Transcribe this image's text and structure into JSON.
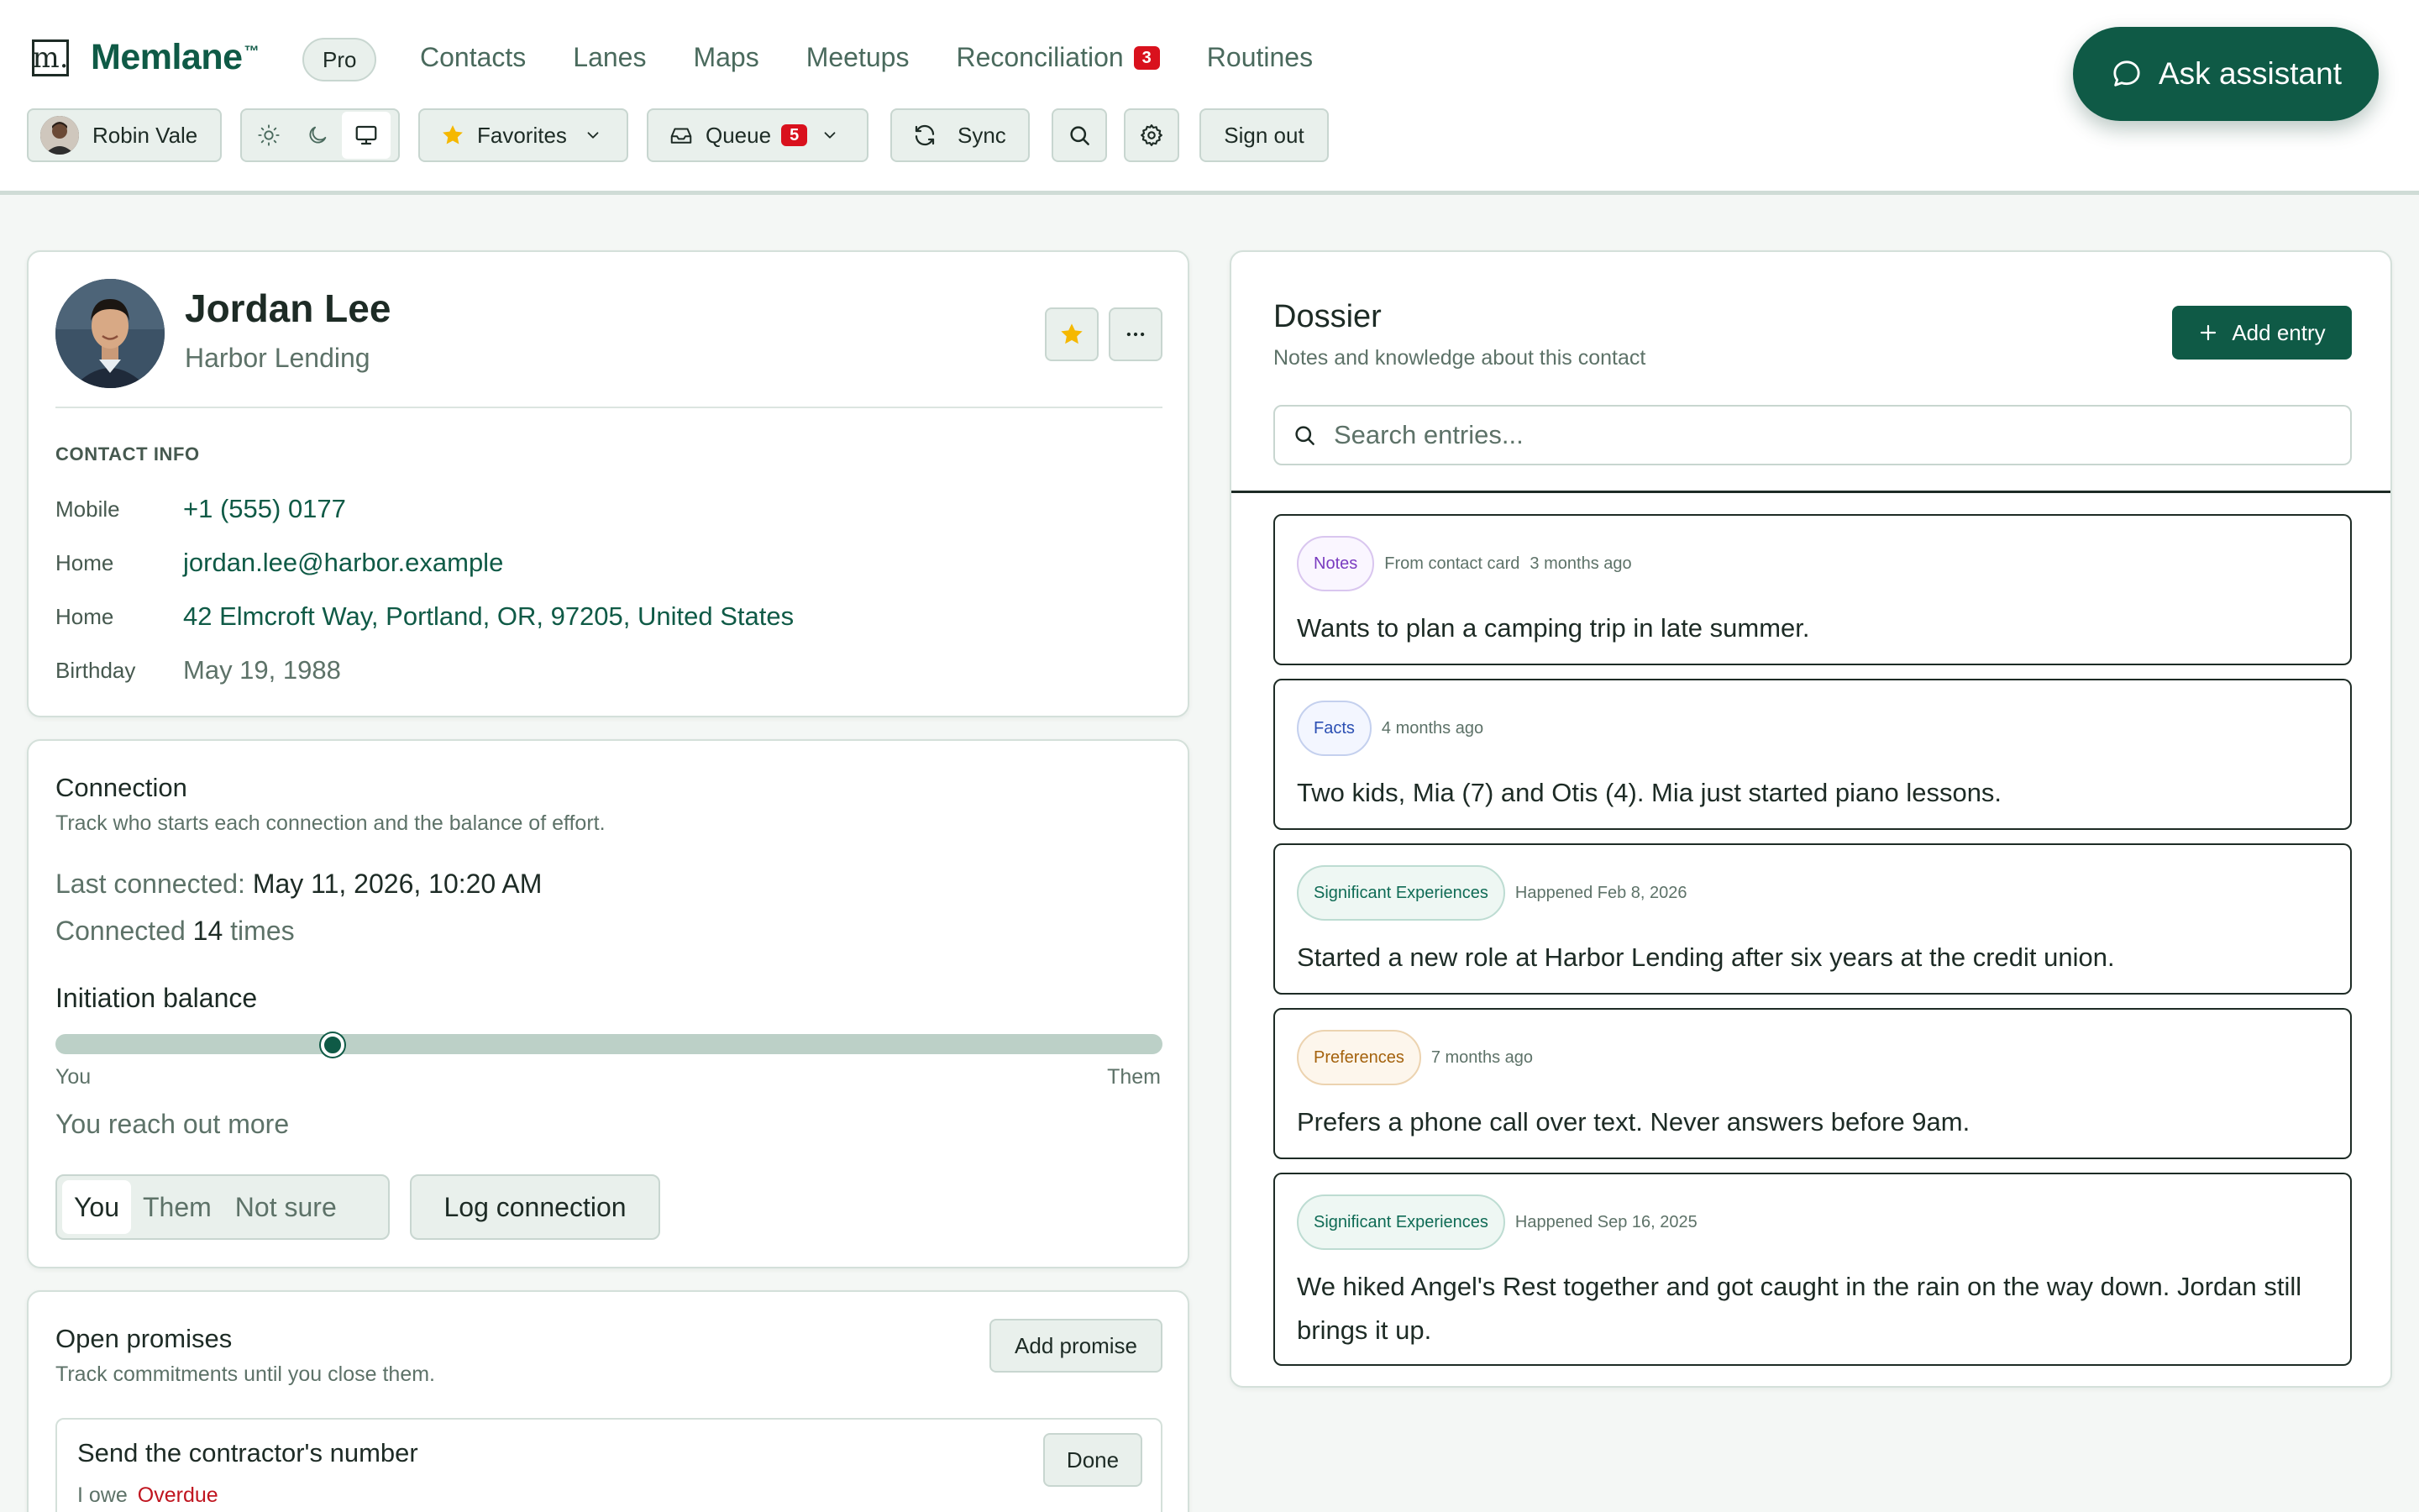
{
  "brand": {
    "logo_glyph": "m.",
    "name": "Memlane",
    "trademark": "™",
    "plan_badge": "Pro"
  },
  "nav": {
    "items": [
      {
        "label": "Contacts"
      },
      {
        "label": "Lanes"
      },
      {
        "label": "Maps"
      },
      {
        "label": "Meetups"
      },
      {
        "label": "Reconciliation",
        "count": "3"
      },
      {
        "label": "Routines"
      }
    ]
  },
  "toolbar": {
    "user_name": "Robin Vale",
    "theme_options": [
      "sun-icon",
      "moon-icon",
      "monitor-icon"
    ],
    "theme_selected": "monitor-icon",
    "favorites_label": "Favorites",
    "queue_label": "Queue",
    "queue_count": "5",
    "sync_label": "Sync",
    "sign_out_label": "Sign out"
  },
  "assistant": {
    "label": "Ask assistant"
  },
  "contact": {
    "name": "Jordan Lee",
    "company": "Harbor Lending",
    "favorited": true,
    "section_label": "CONTACT INFO",
    "info": [
      {
        "key": "Mobile",
        "value": "+1 (555) 0177",
        "link": true
      },
      {
        "key": "Home",
        "value": "jordan.lee@harbor.example",
        "link": true
      },
      {
        "key": "Home",
        "value": "42 Elmcroft Way, Portland, OR, 97205, United States",
        "link": true
      },
      {
        "key": "Birthday",
        "value": "May 19, 1988",
        "link": false
      }
    ]
  },
  "connection": {
    "title": "Connection",
    "subtitle": "Track who starts each connection and the balance of effort.",
    "last_connected_label": "Last connected:",
    "last_connected_value": "May 11, 2026, 10:20 AM",
    "count_prefix": "Connected",
    "count_value": "14",
    "count_suffix": "times",
    "balance_heading": "Initiation balance",
    "balance_fraction": 0.25,
    "left_label": "You",
    "right_label": "Them",
    "balance_summary": "You reach out more",
    "initiator_options": [
      "You",
      "Them",
      "Not sure"
    ],
    "initiator_selected": "You",
    "log_button": "Log connection"
  },
  "promises": {
    "title": "Open promises",
    "subtitle": "Track commitments until you close them.",
    "add_button": "Add promise",
    "items": [
      {
        "title": "Send the contractor's number",
        "direction": "I owe",
        "status": "Overdue",
        "done_label": "Done"
      }
    ]
  },
  "dossier": {
    "title": "Dossier",
    "subtitle": "Notes and knowledge about this contact",
    "add_button": "Add entry",
    "search_placeholder": "Search entries...",
    "entries": [
      {
        "tag": "Notes",
        "tag_style": "notes",
        "meta": [
          "From contact card",
          "3 months ago"
        ],
        "text": "Wants to plan a camping trip in late summer."
      },
      {
        "tag": "Facts",
        "tag_style": "facts",
        "meta": [
          "4 months ago"
        ],
        "text": "Two kids, Mia (7) and Otis (4). Mia just started piano lessons."
      },
      {
        "tag": "Significant Experiences",
        "tag_style": "sig",
        "meta": [
          "Happened Feb 8, 2026"
        ],
        "text": "Started a new role at Harbor Lending after six years at the credit union."
      },
      {
        "tag": "Preferences",
        "tag_style": "pref",
        "meta": [
          "7 months ago"
        ],
        "text": "Prefers a phone call over text. Never answers before 9am."
      },
      {
        "tag": "Significant Experiences",
        "tag_style": "sig",
        "meta": [
          "Happened Sep 16, 2025"
        ],
        "text": "We hiked Angel's Rest together and got caught in the rain on the way down. Jordan still brings it up."
      }
    ]
  },
  "colors": {
    "accent": "#0f5a46",
    "alert": "#d9111d",
    "overdue": "#c0151f",
    "favorite_star": "#f5b800"
  }
}
